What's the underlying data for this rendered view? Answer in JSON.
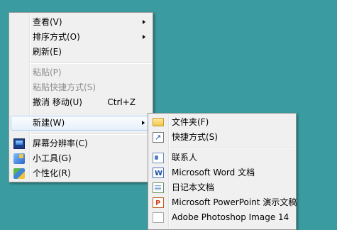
{
  "context_menu": {
    "view": {
      "label": "查看(V)"
    },
    "sort_by": {
      "label": "排序方式(O)"
    },
    "refresh": {
      "label": "刷新(E)"
    },
    "paste": {
      "label": "粘贴(P)"
    },
    "paste_shortcut": {
      "label": "粘贴快捷方式(S)"
    },
    "undo_move": {
      "label": "撤消 移动(U)",
      "shortcut": "Ctrl+Z"
    },
    "new": {
      "label": "新建(W)"
    },
    "screen_resolution": {
      "label": "屏幕分辨率(C)",
      "icon": "display-icon"
    },
    "gadgets": {
      "label": "小工具(G)",
      "icon": "gadget-icon"
    },
    "personalize": {
      "label": "个性化(R)",
      "icon": "personalize-icon"
    }
  },
  "new_submenu": {
    "folder": {
      "label": "文件夹(F)",
      "icon": "folder-icon"
    },
    "shortcut": {
      "label": "快捷方式(S)",
      "icon": "shortcut-icon"
    },
    "contact": {
      "label": "联系人",
      "icon": "contact-icon"
    },
    "word_doc": {
      "label": "Microsoft Word 文档",
      "icon": "word-icon"
    },
    "journal_doc": {
      "label": "日记本文档",
      "icon": "journal-icon"
    },
    "ppt_doc": {
      "label": "Microsoft PowerPoint 演示文稿",
      "icon": "powerpoint-icon"
    },
    "photoshop_image": {
      "label": "Adobe Photoshop Image 14",
      "icon": "file-icon"
    }
  },
  "colors": {
    "desktop_background": "#3a9ca0",
    "menu_background": "#f0f0f0",
    "highlight_border": "#aecff7",
    "disabled_text": "#8d8d8d"
  }
}
